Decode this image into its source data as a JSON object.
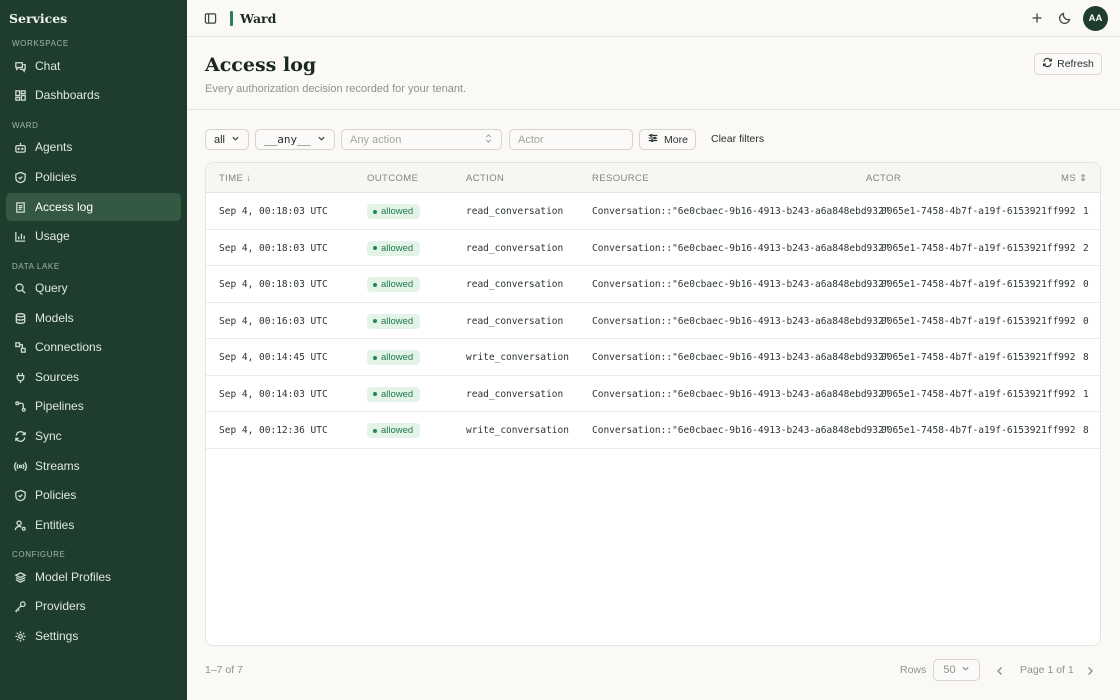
{
  "sidebar": {
    "title": "Services",
    "sections": {
      "workspace": "Workspace",
      "ward": "Ward",
      "data_lake": "Data Lake",
      "configure": "Configure"
    },
    "items": [
      {
        "label": "Chat",
        "icon": "chat-icon"
      },
      {
        "label": "Dashboards",
        "icon": "dashboard-icon"
      },
      {
        "label": "Agents",
        "icon": "bot-icon"
      },
      {
        "label": "Policies",
        "icon": "shield-icon"
      },
      {
        "label": "Access log",
        "icon": "log-icon",
        "active": true
      },
      {
        "label": "Usage",
        "icon": "bar-chart-icon"
      },
      {
        "label": "Query",
        "icon": "search-icon"
      },
      {
        "label": "Models",
        "icon": "database-icon"
      },
      {
        "label": "Connections",
        "icon": "connection-icon"
      },
      {
        "label": "Sources",
        "icon": "plug-icon"
      },
      {
        "label": "Pipelines",
        "icon": "pipeline-icon"
      },
      {
        "label": "Sync",
        "icon": "sync-icon"
      },
      {
        "label": "Streams",
        "icon": "broadcast-icon"
      },
      {
        "label": "Policies",
        "icon": "shield-icon"
      },
      {
        "label": "Entities",
        "icon": "user-cog-icon"
      },
      {
        "label": "Model Profiles",
        "icon": "layers-icon"
      },
      {
        "label": "Providers",
        "icon": "key-icon"
      },
      {
        "label": "Settings",
        "icon": "gear-icon"
      }
    ]
  },
  "topbar": {
    "title": "Ward",
    "avatar": "AA"
  },
  "header": {
    "title": "Access log",
    "subtitle": "Every authorization decision recorded for your tenant.",
    "refresh_label": "Refresh"
  },
  "filters": {
    "outcome": "all",
    "resource_type": "__any__",
    "action_placeholder": "Any action",
    "actor_placeholder": "Actor",
    "more_label": "More",
    "clear_label": "Clear filters"
  },
  "table": {
    "columns": {
      "time": "TIME",
      "outcome": "OUTCOME",
      "action": "ACTION",
      "resource": "RESOURCE",
      "actor": "ACTOR",
      "ms": "MS"
    },
    "rows": [
      {
        "time": "Sep 4, 00:18:03 UTC",
        "outcome": "allowed",
        "action": "read_conversation",
        "resource": "Conversation::\"6e0cbaec-9b16-4913-b243-a6a848ebd932\"",
        "actor": "0065e1-7458-4b7f-a19f-6153921ff992",
        "ms": "1"
      },
      {
        "time": "Sep 4, 00:18:03 UTC",
        "outcome": "allowed",
        "action": "read_conversation",
        "resource": "Conversation::\"6e0cbaec-9b16-4913-b243-a6a848ebd932\"",
        "actor": "0065e1-7458-4b7f-a19f-6153921ff992",
        "ms": "2"
      },
      {
        "time": "Sep 4, 00:18:03 UTC",
        "outcome": "allowed",
        "action": "read_conversation",
        "resource": "Conversation::\"6e0cbaec-9b16-4913-b243-a6a848ebd932\"",
        "actor": "0065e1-7458-4b7f-a19f-6153921ff992",
        "ms": "0"
      },
      {
        "time": "Sep 4, 00:16:03 UTC",
        "outcome": "allowed",
        "action": "read_conversation",
        "resource": "Conversation::\"6e0cbaec-9b16-4913-b243-a6a848ebd932\"",
        "actor": "0065e1-7458-4b7f-a19f-6153921ff992",
        "ms": "0"
      },
      {
        "time": "Sep 4, 00:14:45 UTC",
        "outcome": "allowed",
        "action": "write_conversation",
        "resource": "Conversation::\"6e0cbaec-9b16-4913-b243-a6a848ebd932\"",
        "actor": "0065e1-7458-4b7f-a19f-6153921ff992",
        "ms": "8"
      },
      {
        "time": "Sep 4, 00:14:03 UTC",
        "outcome": "allowed",
        "action": "read_conversation",
        "resource": "Conversation::\"6e0cbaec-9b16-4913-b243-a6a848ebd932\"",
        "actor": "0065e1-7458-4b7f-a19f-6153921ff992",
        "ms": "1"
      },
      {
        "time": "Sep 4, 00:12:36 UTC",
        "outcome": "allowed",
        "action": "write_conversation",
        "resource": "Conversation::\"6e0cbaec-9b16-4913-b243-a6a848ebd932\"",
        "actor": "0065e1-7458-4b7f-a19f-6153921ff992",
        "ms": "8"
      }
    ]
  },
  "footer": {
    "count": "1–7 of 7",
    "rows_label": "Rows",
    "rows_value": "50",
    "page_text": "Page 1 of 1"
  },
  "colors": {
    "sidebar_bg": "#1f3d2c",
    "sidebar_active": "#355843",
    "accent": "#2e7d58",
    "badge_bg": "#e3f3e8",
    "badge_text": "#1f7a49"
  }
}
